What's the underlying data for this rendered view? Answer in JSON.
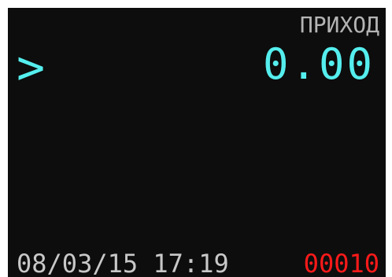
{
  "display": {
    "mode_label": "ПРИХОД",
    "prompt_symbol": ">",
    "amount": "0.00",
    "datetime": "08/03/15 17:19",
    "counter": "00010"
  },
  "colors": {
    "background": "#0d0d0d",
    "mode_label": "#b4b4b4",
    "value": "#55eeee",
    "datetime": "#c8c8c8",
    "counter": "#ff1a1a"
  }
}
